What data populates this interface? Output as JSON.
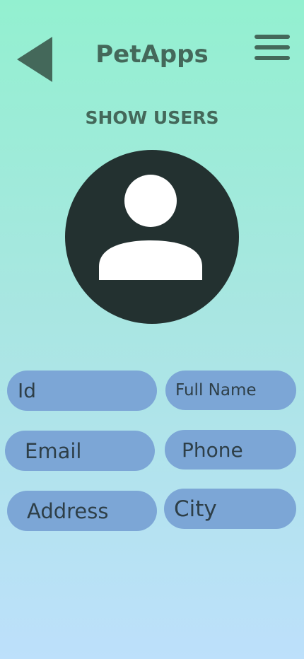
{
  "header": {
    "back_icon": "back-triangle-icon",
    "title": "PetApps",
    "menu_icon": "hamburger-menu-icon"
  },
  "page": {
    "section_title": "SHOW USERS"
  },
  "avatar": {
    "icon": "user-silhouette-icon"
  },
  "form": {
    "fields": {
      "id": "Id",
      "full_name": "Full Name",
      "email": "Email",
      "phone": "Phone",
      "address": "Address",
      "city": "City"
    }
  },
  "colors": {
    "background_top": "#93f0d0",
    "background_bottom": "#bde0fb",
    "accent": "#44685a",
    "avatar_bg": "#233130",
    "field_bg": "#7ca6d6",
    "field_text": "#2e3f48"
  }
}
